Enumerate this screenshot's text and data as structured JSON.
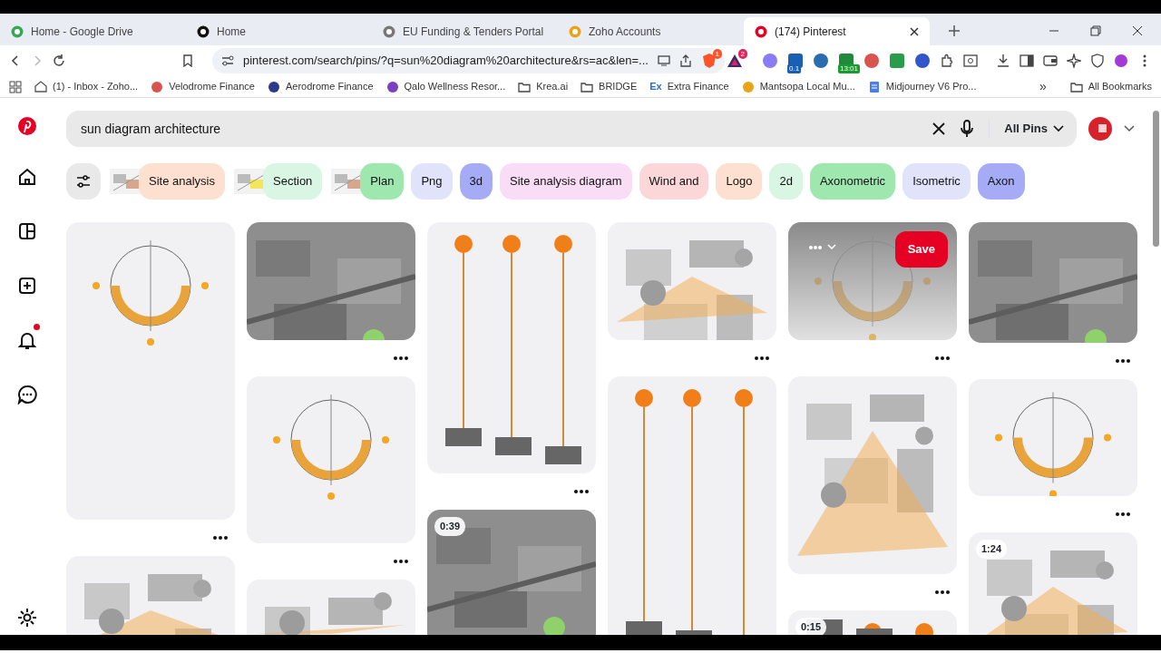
{
  "browser_tabs": [
    {
      "title": "Home - Google Drive",
      "selected": false,
      "color": "#34a853"
    },
    {
      "title": "Home",
      "selected": false,
      "color": "#111111"
    },
    {
      "title": "EU Funding & Tenders Portal",
      "selected": false,
      "color": "#777777"
    },
    {
      "title": "Zoho Accounts",
      "selected": false,
      "color": "#e8a317"
    },
    {
      "title": "(174) Pinterest",
      "selected": true,
      "color": "#e60023"
    }
  ],
  "address_bar": {
    "url": "pinterest.com/search/pins/?q=sun%20diagram%20architecture&rs=ac&len=..."
  },
  "toolbar_badges": [
    {
      "text": "1",
      "color": "#fb542b"
    },
    {
      "text": "2",
      "color": "#e0245e"
    }
  ],
  "extensions": [
    {
      "color": "#8b7cf6"
    },
    {
      "color": "#1a5fb4",
      "badge": "0.1"
    },
    {
      "color": "#2b6cb0"
    },
    {
      "color": "#1f8a3b",
      "badge": "13:01"
    },
    {
      "color": "#d9534f"
    },
    {
      "color": "#2a9d4b"
    },
    {
      "color": "#3355cc"
    }
  ],
  "bookmarks": [
    {
      "label": "(1) - Inbox - Zoho...",
      "kind": "mail"
    },
    {
      "label": "Velodrome Finance",
      "kind": "site",
      "color": "#d9534f"
    },
    {
      "label": "Aerodrome Finance",
      "kind": "site",
      "color": "#2b3a8c"
    },
    {
      "label": "Qalo Wellness Resor...",
      "kind": "site",
      "color": "#7b3fbf"
    },
    {
      "label": "Krea.ai",
      "kind": "folder"
    },
    {
      "label": "BRIDGE",
      "kind": "folder"
    },
    {
      "label": "Extra Finance",
      "kind": "text",
      "icon_text": "Ex"
    },
    {
      "label": "Mantsopa Local Mu...",
      "kind": "site",
      "color": "#e8a317"
    },
    {
      "label": "Midjourney V6 Pro...",
      "kind": "doc"
    }
  ],
  "overflow_label": "»",
  "all_bookmarks": "All Bookmarks",
  "sidebar": {
    "items": [
      {
        "kind": "home",
        "notification": false
      },
      {
        "kind": "explore",
        "notification": false
      },
      {
        "kind": "create",
        "notification": false
      },
      {
        "kind": "bell",
        "notification": true
      },
      {
        "kind": "messages",
        "notification": false
      }
    ]
  },
  "search": {
    "value": "sun diagram architecture",
    "scope": "All Pins"
  },
  "chips": [
    {
      "label": "Site analysis",
      "color": "#fde0d0"
    },
    {
      "label": "Section",
      "color": "#d9f5e3"
    },
    {
      "label": "Plan",
      "color": "#9ee8b0"
    },
    {
      "label": "Png",
      "kind": "plain",
      "color": "#e1e3fb"
    },
    {
      "label": "3d",
      "kind": "plain",
      "color": "#a5acf5"
    },
    {
      "label": "Site analysis diagram",
      "kind": "plain",
      "color": "#f9dcf5"
    },
    {
      "label": "Wind and",
      "kind": "plain",
      "color": "#fbd7d9"
    },
    {
      "label": "Logo",
      "kind": "plain",
      "color": "#fde0d0"
    },
    {
      "label": "2d",
      "kind": "plain",
      "color": "#d9f5e3"
    },
    {
      "label": "Axonometric",
      "kind": "plain",
      "color": "#9ee8b0"
    },
    {
      "label": "Isometric",
      "kind": "plain",
      "color": "#e1e3fb"
    },
    {
      "label": "Axon",
      "kind": "plain",
      "color": "#a5acf5"
    }
  ],
  "pin_columns": [
    {
      "pins": [
        {
          "kind": "picture"
        },
        {
          "kind": "picture"
        }
      ]
    },
    {
      "pins": [
        {
          "kind": "picture"
        },
        {
          "kind": "picture"
        },
        {
          "kind": "picture"
        }
      ]
    },
    {
      "pins": [
        {
          "kind": "picture"
        },
        {
          "kind": "picture",
          "duration": "0:39"
        }
      ]
    },
    {
      "pins": [
        {
          "kind": "picture"
        },
        {
          "kind": "picture"
        }
      ]
    },
    {
      "pins": [
        {
          "kind": "picture",
          "hovered": true,
          "save_label": "Save"
        },
        {
          "kind": "picture"
        },
        {
          "kind": "picture",
          "duration": "0:15"
        }
      ]
    },
    {
      "pins": [
        {
          "kind": "picture"
        },
        {
          "kind": "picture"
        },
        {
          "kind": "picture",
          "duration": "1:24"
        }
      ]
    }
  ]
}
